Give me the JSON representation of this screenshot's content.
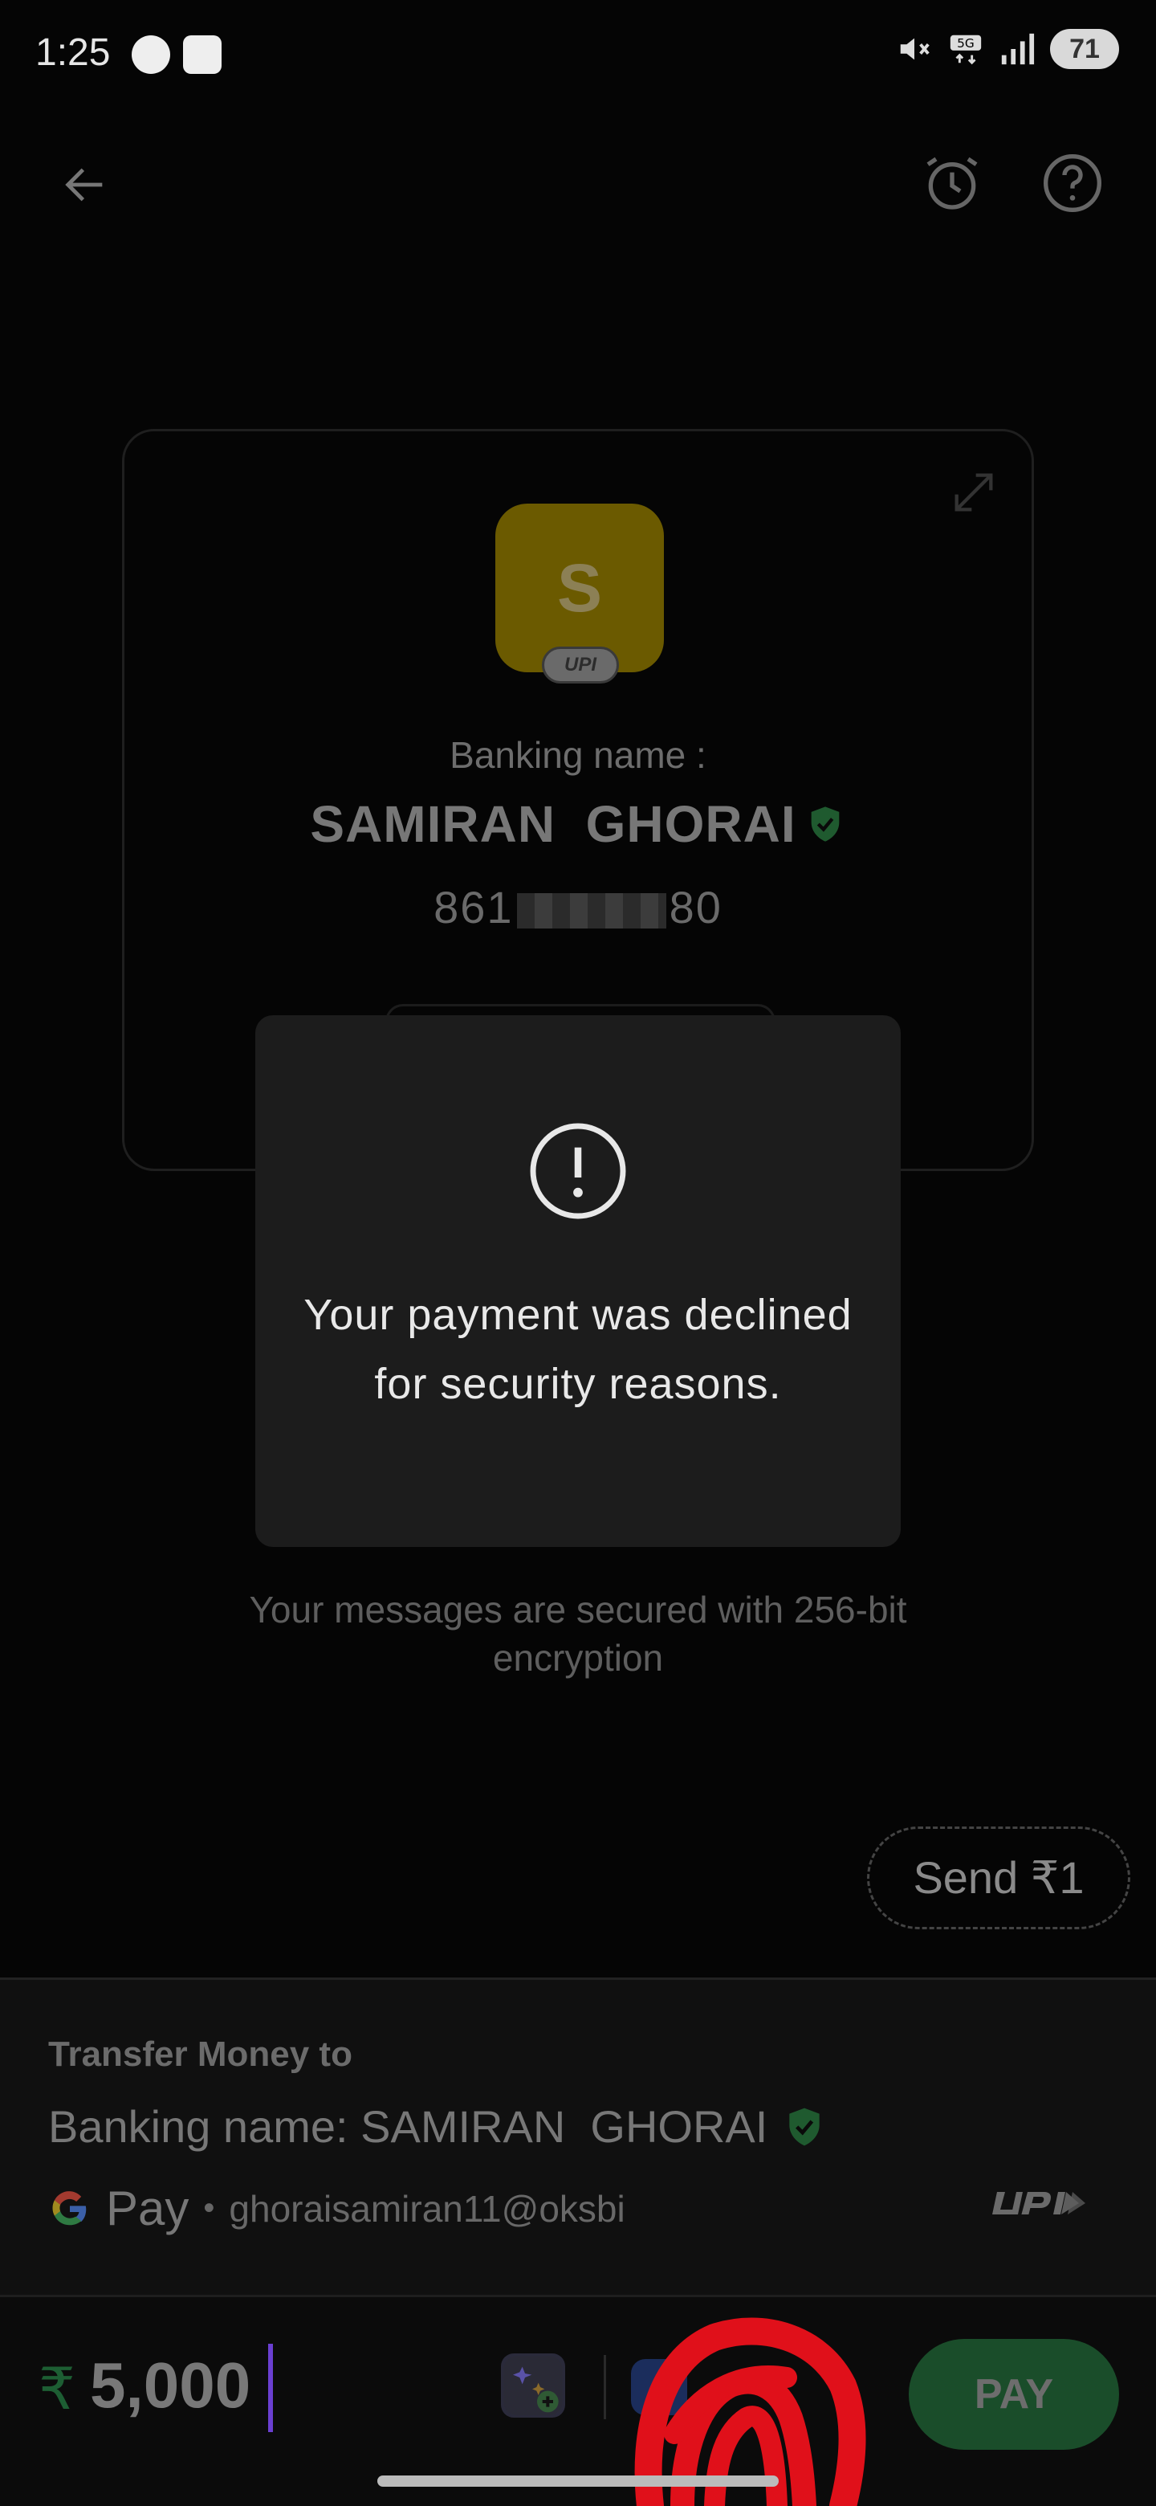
{
  "status_bar": {
    "time": "1:25",
    "battery": "71",
    "network": "5G"
  },
  "contact": {
    "avatar_initial": "S",
    "upi_badge": "UPI",
    "banking_label": "Banking name :",
    "name": "SAMIRAN  GHORAI",
    "phone_prefix": "861",
    "phone_suffix": "80"
  },
  "dialog": {
    "message": "Your payment was declined for security reasons."
  },
  "secure_message": "Your messages are secured with 256-bit encryption",
  "send_chip": "Send ₹1",
  "transfer": {
    "title": "Transfer Money to",
    "banking_name": "Banking name: SAMIRAN  GHORAI",
    "pay_label": "Pay",
    "separator": "•",
    "upi_id": "ghoraisamiran11@oksbi"
  },
  "amount_bar": {
    "currency": "₹",
    "amount": "5,000",
    "account_text": "",
    "pay_button": "PAY"
  },
  "colors": {
    "background": "#050505",
    "dialog": "#1c1c1c",
    "pay_button": "#1a4d2a",
    "verified": "#1f7a3a",
    "avatar": "#6b5a00",
    "scribble": "#e0101a"
  }
}
